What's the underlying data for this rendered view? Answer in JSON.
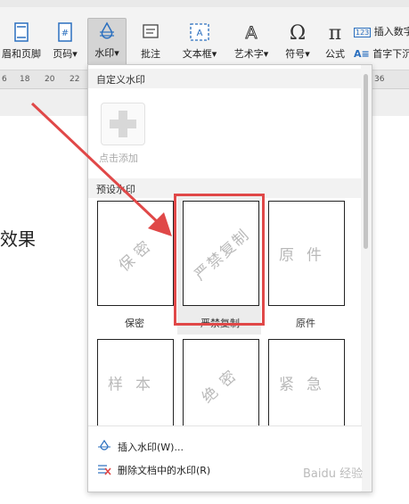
{
  "ribbon": {
    "buttons": [
      {
        "id": "header-footer",
        "label": "眉和页脚",
        "icon": "header-footer-icon"
      },
      {
        "id": "page-number",
        "label": "页码",
        "icon": "page-number-icon"
      },
      {
        "id": "watermark",
        "label": "水印",
        "icon": "watermark-icon"
      },
      {
        "id": "comment",
        "label": "批注",
        "icon": "comment-icon"
      },
      {
        "id": "textbox",
        "label": "文本框",
        "icon": "textbox-icon"
      },
      {
        "id": "wordart",
        "label": "艺术字",
        "icon": "wordart-icon"
      },
      {
        "id": "symbol",
        "label": "符号",
        "icon": "omega-icon"
      },
      {
        "id": "formula",
        "label": "公式",
        "icon": "pi-icon"
      }
    ],
    "insert_number": "插入数字",
    "drop_cap": "首字下沉"
  },
  "ruler": {
    "ticks": [
      "6",
      "18",
      "20",
      "22",
      "36"
    ]
  },
  "document": {
    "text": "效果"
  },
  "watermark_menu": {
    "custom_title": "自定义水印",
    "add_label": "点击添加",
    "preset_title": "预设水印",
    "presets": [
      {
        "name": "保密",
        "text": "保密",
        "rotated": true
      },
      {
        "name": "严禁复制",
        "text": "严禁复制",
        "rotated": true
      },
      {
        "name": "原件",
        "text": "原件",
        "rotated": false
      },
      {
        "name": "样本",
        "text": "样本",
        "rotated": false
      },
      {
        "name": "绝密",
        "text": "绝密",
        "rotated": true
      },
      {
        "name": "紧急",
        "text": "紧急",
        "rotated": false
      }
    ],
    "insert_item": "插入水印(W)...",
    "delete_item": "删除文档中的水印(R)"
  },
  "colors": {
    "highlight": "#e04848",
    "arrow": "#e04848"
  }
}
